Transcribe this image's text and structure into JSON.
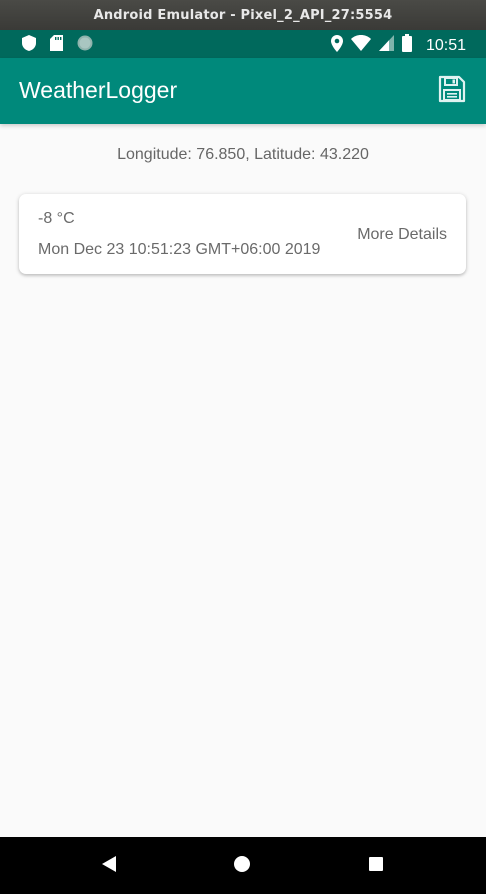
{
  "window": {
    "title": "Android Emulator - Pixel_2_API_27:5554"
  },
  "status_bar": {
    "time": "10:51",
    "left_icons": [
      "shield-icon",
      "sd-card-icon",
      "circle-indicator-icon"
    ],
    "right_icons": [
      "location-icon",
      "wifi-icon",
      "signal-icon",
      "battery-icon"
    ],
    "color": "#00695c"
  },
  "app_bar": {
    "title": "WeatherLogger",
    "action_icon": "save-icon",
    "color": "#00897b"
  },
  "location": {
    "text": "Longitude: 76.850, Latitude: 43.220"
  },
  "entries": [
    {
      "temperature": "-8 °C",
      "timestamp": "Mon Dec 23 10:51:23 GMT+06:00 2019",
      "action_label": "More Details"
    }
  ],
  "nav_bar": {
    "buttons": [
      "back-icon",
      "home-icon",
      "recents-icon"
    ]
  }
}
